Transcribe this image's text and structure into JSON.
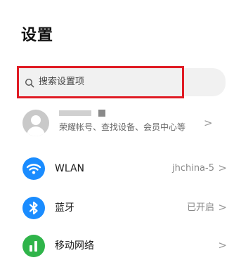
{
  "page": {
    "title": "设置"
  },
  "search": {
    "placeholder": "搜索设置项",
    "icon": "search-icon",
    "highlight_color": "#e01b24"
  },
  "account": {
    "subtitle": "荣耀帐号、查找设备、会员中心等",
    "chevron": ">"
  },
  "settings": [
    {
      "label": "WLAN",
      "value": "jhchina-5",
      "chevron": ">",
      "icon": "wifi-icon",
      "icon_color": "#1a8cff"
    },
    {
      "label": "蓝牙",
      "value": "已开启",
      "chevron": ">",
      "icon": "bluetooth-icon",
      "icon_color": "#1a8cff"
    },
    {
      "label": "移动网络",
      "value": "",
      "chevron": ">",
      "icon": "mobile-network-icon",
      "icon_color": "#2fb44a"
    }
  ]
}
